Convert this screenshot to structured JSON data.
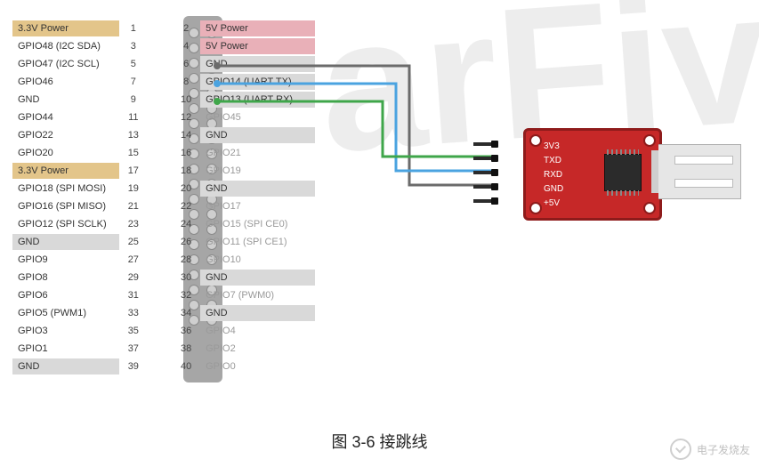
{
  "caption": "图 3-6 接跳线",
  "site_watermark": "电子发烧友",
  "bg_watermark_text": "arFiv",
  "uart_module": {
    "pins": [
      "3V3",
      "TXD",
      "RXD",
      "GND",
      "+5V"
    ]
  },
  "connections": [
    {
      "from_pin": 6,
      "to_uart": "GND",
      "signal": "GND",
      "color": "#6b6b6b"
    },
    {
      "from_pin": 8,
      "to_uart": "RXD",
      "signal": "UART TX",
      "color": "#4aa3e0"
    },
    {
      "from_pin": 10,
      "to_uart": "TXD",
      "signal": "UART RX",
      "color": "#3fa64a"
    }
  ],
  "pins_left": [
    {
      "n": 1,
      "label": "3.3V Power",
      "hl": "pwr3v3"
    },
    {
      "n": 3,
      "label": "GPIO48 (I2C SDA)",
      "hl": null
    },
    {
      "n": 5,
      "label": "GPIO47 (I2C SCL)",
      "hl": null
    },
    {
      "n": 7,
      "label": "GPIO46",
      "hl": null
    },
    {
      "n": 9,
      "label": "GND",
      "hl": null
    },
    {
      "n": 11,
      "label": "GPIO44",
      "hl": null
    },
    {
      "n": 13,
      "label": "GPIO22",
      "hl": null
    },
    {
      "n": 15,
      "label": "GPIO20",
      "hl": null
    },
    {
      "n": 17,
      "label": "3.3V Power",
      "hl": "pwr3v3"
    },
    {
      "n": 19,
      "label": "GPIO18 (SPI MOSI)",
      "hl": null
    },
    {
      "n": 21,
      "label": "GPIO16 (SPI MISO)",
      "hl": null
    },
    {
      "n": 23,
      "label": "GPIO12 (SPI SCLK)",
      "hl": null
    },
    {
      "n": 25,
      "label": "GND",
      "hl": "gnd"
    },
    {
      "n": 27,
      "label": "GPIO9",
      "hl": null
    },
    {
      "n": 29,
      "label": "GPIO8",
      "hl": null
    },
    {
      "n": 31,
      "label": "GPIO6",
      "hl": null
    },
    {
      "n": 33,
      "label": "GPIO5 (PWM1)",
      "hl": null
    },
    {
      "n": 35,
      "label": "GPIO3",
      "hl": null
    },
    {
      "n": 37,
      "label": "GPIO1",
      "hl": null
    },
    {
      "n": 39,
      "label": "GND",
      "hl": "gnd"
    }
  ],
  "pins_right": [
    {
      "n": 2,
      "label": "5V Power",
      "hl": "pwr5v"
    },
    {
      "n": 4,
      "label": "5V Power",
      "hl": "pwr5v"
    },
    {
      "n": 6,
      "label": "GND",
      "hl": "gnd"
    },
    {
      "n": 8,
      "label": "GPIO14 (UART TX)",
      "hl": "gnd"
    },
    {
      "n": 10,
      "label": "GPIO13 (UART RX)",
      "hl": "gnd"
    },
    {
      "n": 12,
      "label": "GPIO45",
      "hl": null
    },
    {
      "n": 14,
      "label": "GND",
      "hl": "gnd"
    },
    {
      "n": 16,
      "label": "GPIO21",
      "hl": null
    },
    {
      "n": 18,
      "label": "GPIO19",
      "hl": null
    },
    {
      "n": 20,
      "label": "GND",
      "hl": "gnd"
    },
    {
      "n": 22,
      "label": "GPIO17",
      "hl": null
    },
    {
      "n": 24,
      "label": "GPIO15 (SPI CE0)",
      "hl": null
    },
    {
      "n": 26,
      "label": "GPIO11 (SPI CE1)",
      "hl": null
    },
    {
      "n": 28,
      "label": "GPIO10",
      "hl": null
    },
    {
      "n": 30,
      "label": "GND",
      "hl": "gnd"
    },
    {
      "n": 32,
      "label": "GPIO7 (PWM0)",
      "hl": null
    },
    {
      "n": 34,
      "label": "GND",
      "hl": "gnd"
    },
    {
      "n": 36,
      "label": "GPIO4",
      "hl": null
    },
    {
      "n": 38,
      "label": "GPIO2",
      "hl": null
    },
    {
      "n": 40,
      "label": "GPIO0",
      "hl": null
    }
  ]
}
